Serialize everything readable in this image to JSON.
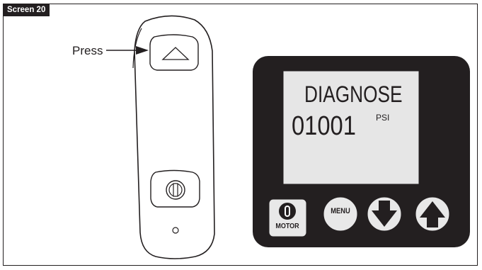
{
  "screen_tag": "Screen 20",
  "callout": {
    "label": "Press"
  },
  "display": {
    "mode_text": "DIAGNOSE",
    "value": "01001",
    "unit": "PSI"
  },
  "keypad": {
    "motor_label": "MOTOR",
    "menu_label": "MENU"
  },
  "icons": {
    "remote_up": "triangle-up-outline-icon",
    "remote_stop": "stop-circle-icon",
    "motor": "motor-power-icon",
    "down": "arrow-down-icon",
    "up": "arrow-up-icon"
  },
  "colors": {
    "ink": "#231f20",
    "screen_fill": "#e6e6e6",
    "button_fill": "#e8e8e8",
    "background": "#ffffff"
  }
}
